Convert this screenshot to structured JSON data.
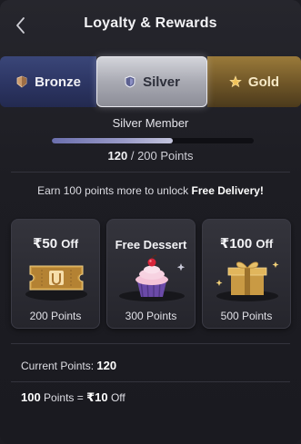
{
  "header": {
    "title": "Loyalty & Rewards",
    "back_icon": "chevron-left-icon"
  },
  "tiers": [
    {
      "label": "Bronze",
      "icon": "bronze-badge-icon",
      "selected": false,
      "color": "#2c3563"
    },
    {
      "label": "Silver",
      "icon": "silver-shield-icon",
      "selected": true,
      "color": "#a9aab3"
    },
    {
      "label": "Gold",
      "icon": "gold-star-icon",
      "selected": false,
      "color": "#6e5527"
    }
  ],
  "membership": {
    "label": "Silver Member",
    "current_points": "120",
    "points_separator": "/",
    "target_text": "200 Points",
    "progress_fraction": 0.6
  },
  "earn_message": {
    "prefix": "Earn 100 points more to unlock",
    "highlight": "Free Delivery!"
  },
  "rewards": [
    {
      "title_amount": "₹50",
      "title_suffix": "Off",
      "icon": "ticket-icon",
      "points_label": "200 Points"
    },
    {
      "title": "Free Dessert",
      "icon": "cupcake-icon",
      "points_label": "300 Points"
    },
    {
      "title_amount": "₹100",
      "title_suffix": "Off",
      "icon": "gift-box-icon",
      "points_label": "500 Points"
    }
  ],
  "summary": {
    "current_label": "Current Points:",
    "current_value": "120",
    "conversion_points": "100",
    "conversion_mid": "Points =",
    "conversion_value": "₹10",
    "conversion_suffix": "Off"
  }
}
